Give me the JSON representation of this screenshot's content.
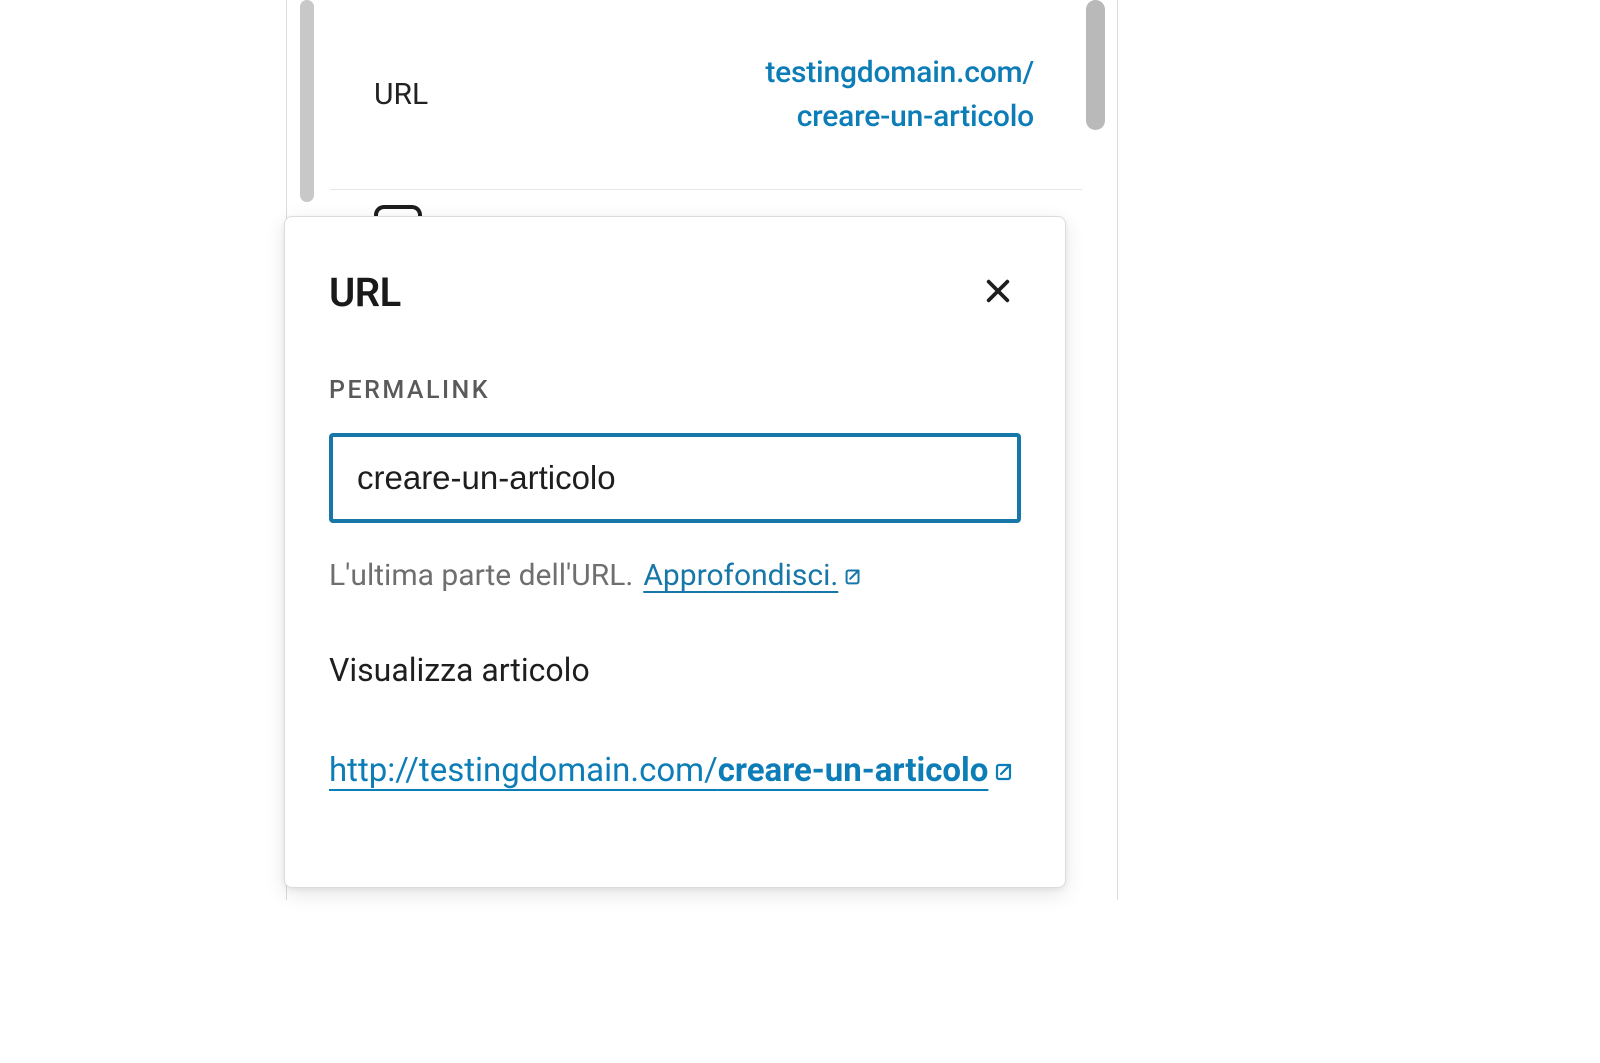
{
  "bg_row": {
    "label": "URL",
    "value_line1": "testingdomain.com/",
    "value_line2": "creare-un-articolo"
  },
  "popover": {
    "title": "URL",
    "permalink_label": "PERMALINK",
    "permalink_value": "creare-un-articolo",
    "help_text": "L'ultima parte dell'URL.",
    "help_link_text": "Approfondisci.",
    "view_label": "Visualizza articolo",
    "full_url_prefix": "http://testingdomain.com/",
    "full_url_slug": "creare-un-articolo"
  },
  "colors": {
    "link": "#0d7db8",
    "focus": "#1777a8"
  }
}
